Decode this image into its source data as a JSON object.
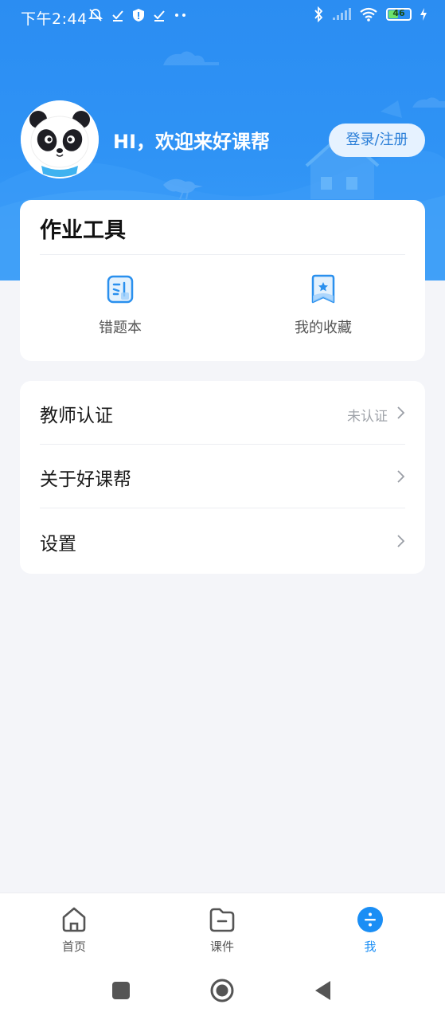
{
  "status_bar": {
    "time": "下午2:44",
    "battery_level": "46",
    "battery_percent": 46,
    "icons": [
      "mute-icon",
      "check-icon",
      "shield-icon",
      "check-icon",
      "more-dots-icon",
      "bluetooth-icon",
      "signal-icon",
      "wifi-icon",
      "battery-icon",
      "charging-icon"
    ]
  },
  "profile": {
    "greeting": "HI，欢迎来好课帮",
    "login_label": "登录/注册"
  },
  "tools": {
    "title": "作业工具",
    "items": [
      {
        "label": "错题本",
        "icon": "mistake-notebook-icon"
      },
      {
        "label": "我的收藏",
        "icon": "favorites-bookmark-icon"
      }
    ]
  },
  "menu": {
    "items": [
      {
        "label": "教师认证",
        "value": "未认证"
      },
      {
        "label": "关于好课帮",
        "value": ""
      },
      {
        "label": "设置",
        "value": ""
      }
    ]
  },
  "bottom_nav": {
    "items": [
      {
        "label": "首页",
        "icon": "home-icon"
      },
      {
        "label": "课件",
        "icon": "courseware-folder-icon"
      },
      {
        "label": "我",
        "icon": "me-icon"
      }
    ],
    "active_index": 2
  },
  "colors": {
    "accent": "#1a8ef5",
    "header": "#2f93f5",
    "background": "#f4f5f9"
  }
}
